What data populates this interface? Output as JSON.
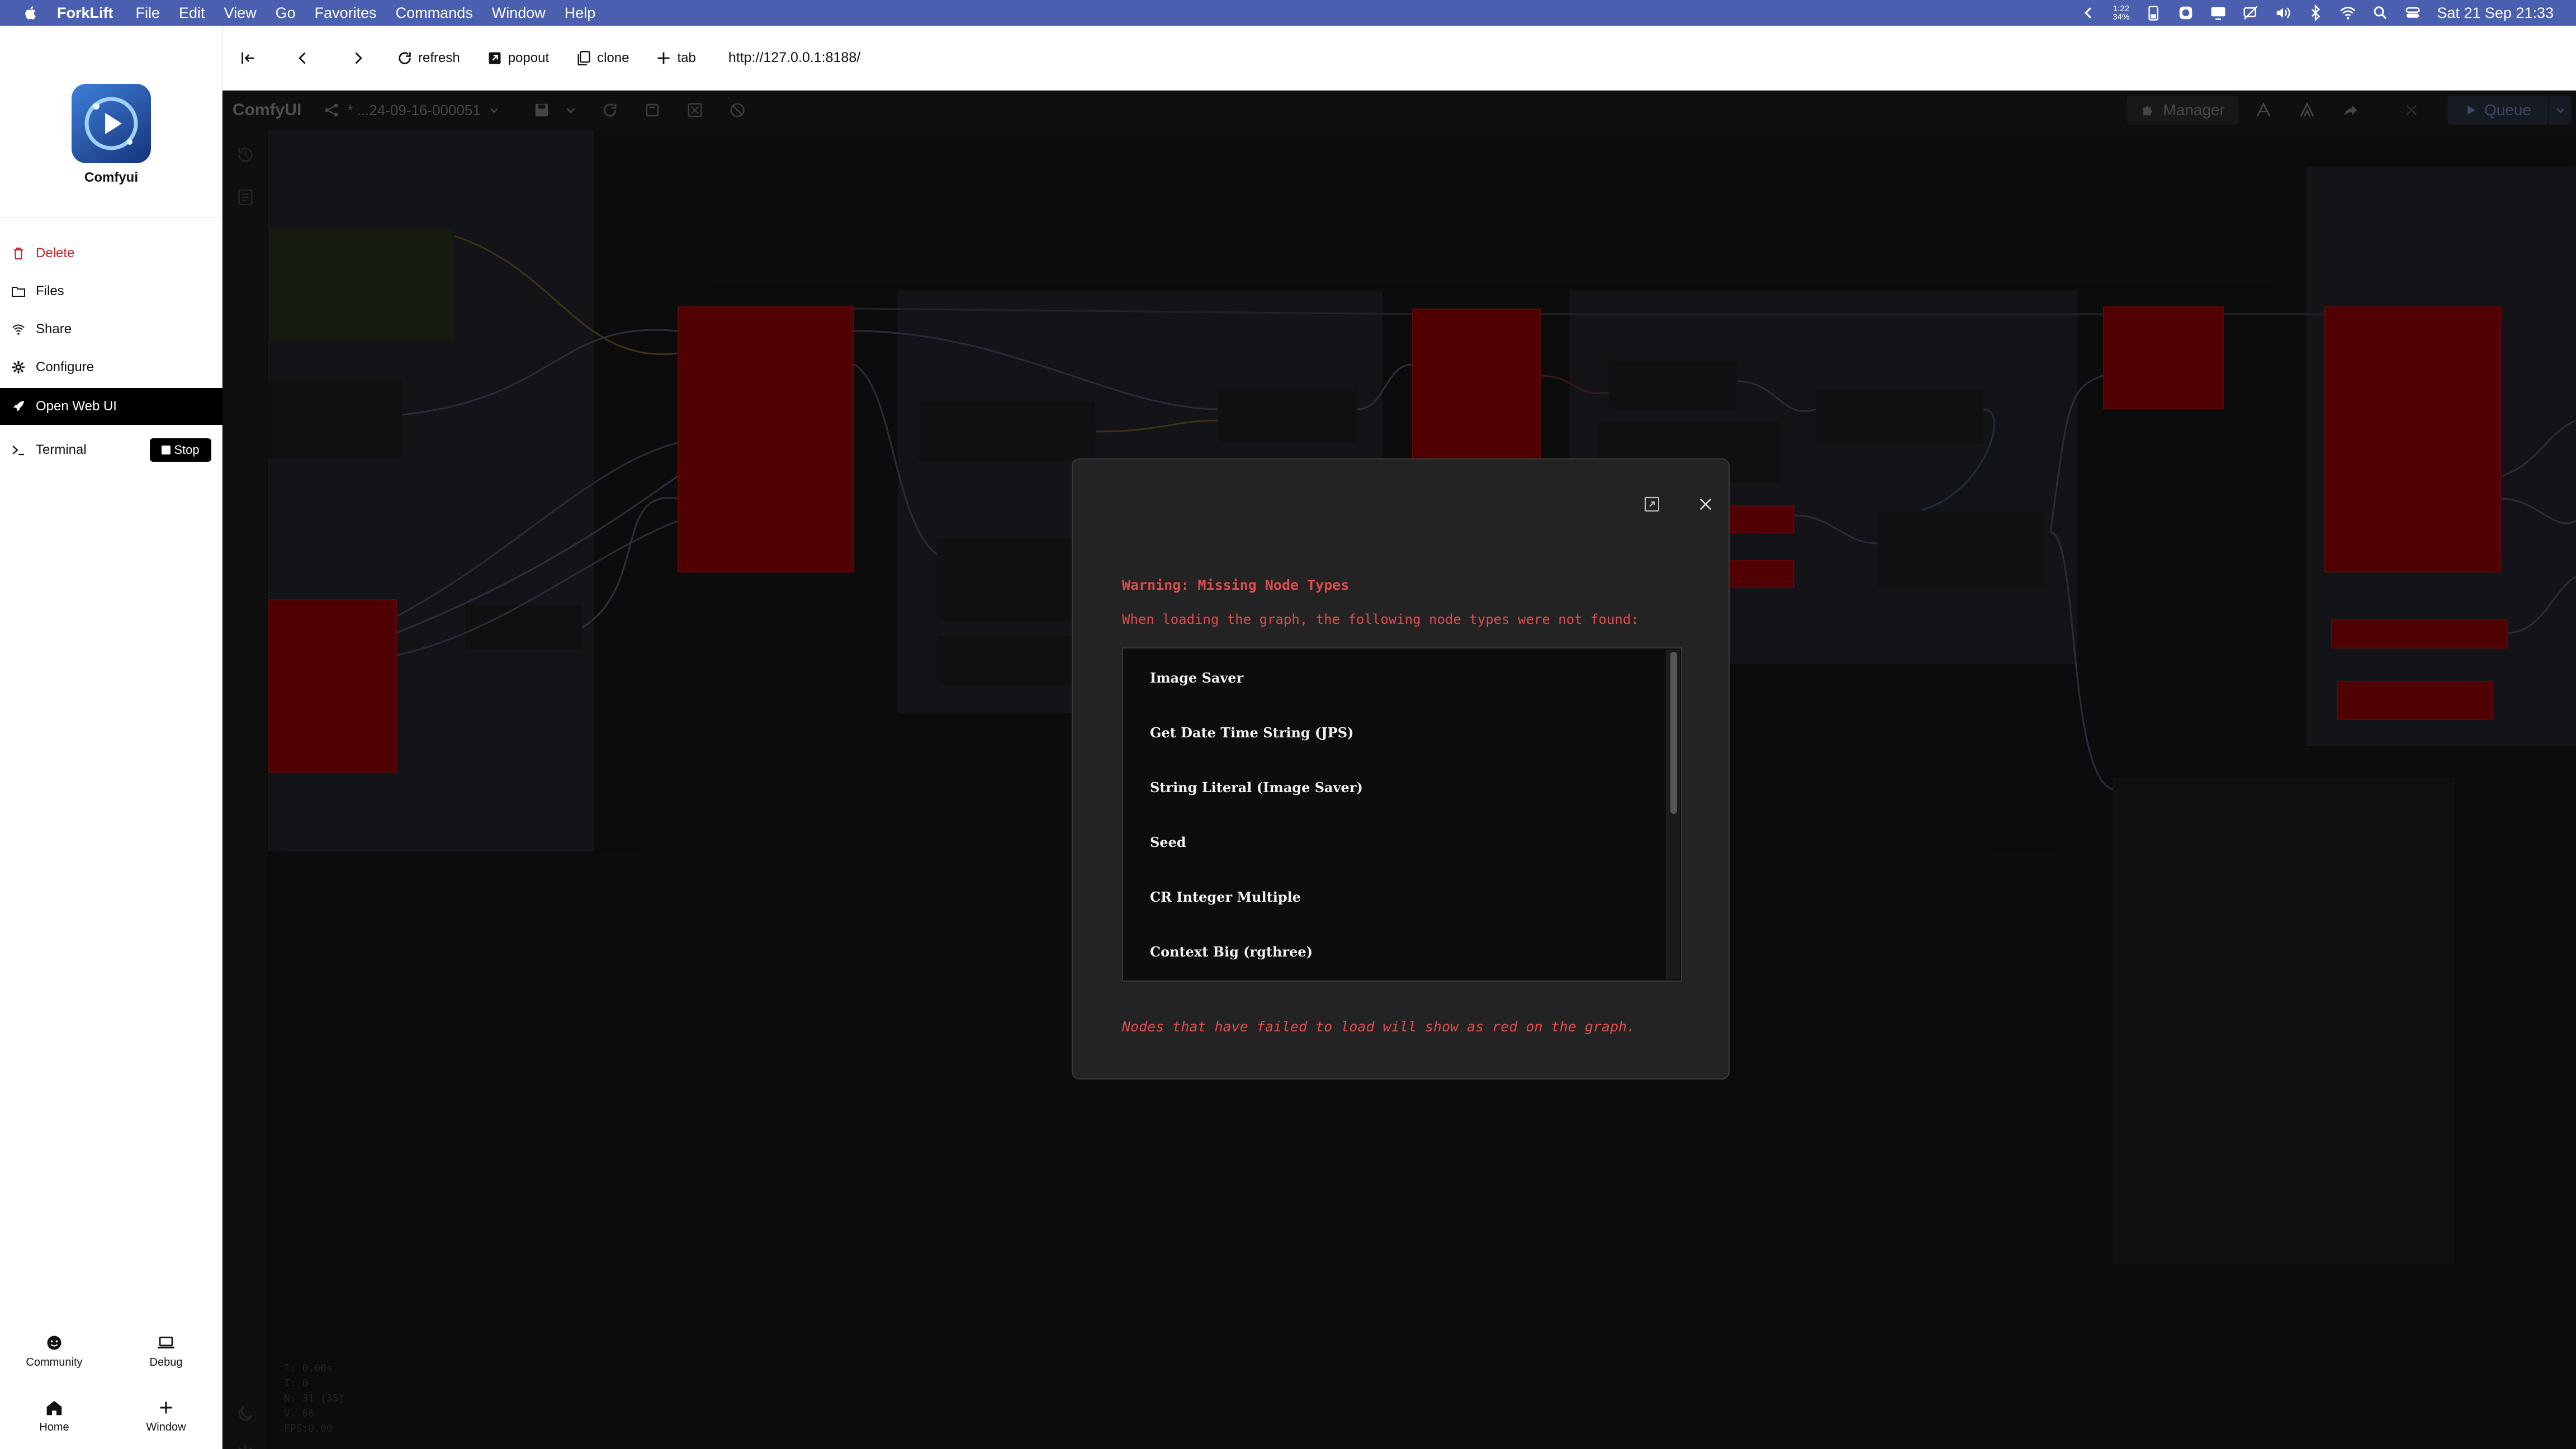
{
  "menubar": {
    "app_name": "ForkLift",
    "items": [
      "File",
      "Edit",
      "View",
      "Go",
      "Favorites",
      "Commands",
      "Window",
      "Help"
    ],
    "battery_time": "1:22",
    "battery_pct": "34%",
    "datetime": "Sat 21 Sep  21:33"
  },
  "sidebar": {
    "app_name": "Comfyui",
    "items": [
      {
        "label": "Delete",
        "icon": "trash-icon"
      },
      {
        "label": "Files",
        "icon": "folder-icon"
      },
      {
        "label": "Share",
        "icon": "wifi-icon"
      },
      {
        "label": "Configure",
        "icon": "gear-icon"
      },
      {
        "label": "Open Web UI",
        "icon": "rocket-icon"
      },
      {
        "label": "Terminal",
        "icon": "terminal-icon"
      }
    ],
    "stop_label": "Stop",
    "bottom": [
      {
        "label": "Community",
        "icon": "smile-icon"
      },
      {
        "label": "Debug",
        "icon": "laptop-icon"
      },
      {
        "label": "Home",
        "icon": "home-icon"
      },
      {
        "label": "Window",
        "icon": "plus-icon"
      }
    ]
  },
  "toolbar": {
    "refresh": "refresh",
    "popout": "popout",
    "clone": "clone",
    "tab": "tab",
    "url": "http://127.0.0.1:8188/"
  },
  "comfy": {
    "logo": "ComfyUI",
    "workflow": "* ...24-09-16-000051",
    "manager": "Manager",
    "queue": "Queue",
    "stats": [
      "T: 0.00s",
      "I: 0",
      "N: 31 [35]",
      "V: 66",
      "FPS:0.00"
    ]
  },
  "dialog": {
    "title": "Warning: Missing Node Types",
    "description": "When loading the graph, the following node types were not found:",
    "missing_nodes": [
      "Image Saver",
      "Get Date Time String (JPS)",
      "String Literal (Image Saver)",
      "Seed",
      "CR Integer Multiple",
      "Context Big (rgthree)"
    ],
    "footer": "Nodes that have failed to load will show as red on the graph."
  },
  "colors": {
    "menubar": "#4a5fb0",
    "missing_node_red": "#8b0000",
    "warning_text": "#e04d4d"
  }
}
